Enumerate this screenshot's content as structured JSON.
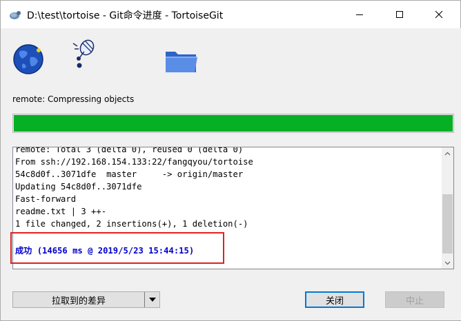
{
  "window": {
    "title": "D:\\test\\tortoise - Git命令进度 - TortoiseGit",
    "controls": {
      "minimize": "—",
      "maximize": "☐",
      "close": "✕"
    }
  },
  "status": {
    "text": "remote: Compressing objects",
    "progress_fraction": 1.0,
    "progress_color": "#06b025"
  },
  "log": {
    "lines": [
      "remote: Total 3 (delta 0), reused 0 (delta 0)",
      "From ssh://192.168.154.133:22/fangqyou/tortoise",
      "54c8d0f..3071dfe  master     -> origin/master",
      "Updating 54c8d0f..3071dfe",
      "Fast-forward",
      "readme.txt | 3 ++-",
      "1 file changed, 2 insertions(+), 1 deletion(-)"
    ],
    "success": "成功 (14656 ms @ 2019/5/23 15:44:15)",
    "success_color": "#0000cc"
  },
  "buttons": {
    "diff": "拉取到的差异",
    "close": "关闭",
    "abort": "中止"
  },
  "icons": {
    "app": "tortoisegit-icon",
    "globe": "globe-icon",
    "turtle": "turtle-icon",
    "folder": "folder-icon"
  }
}
